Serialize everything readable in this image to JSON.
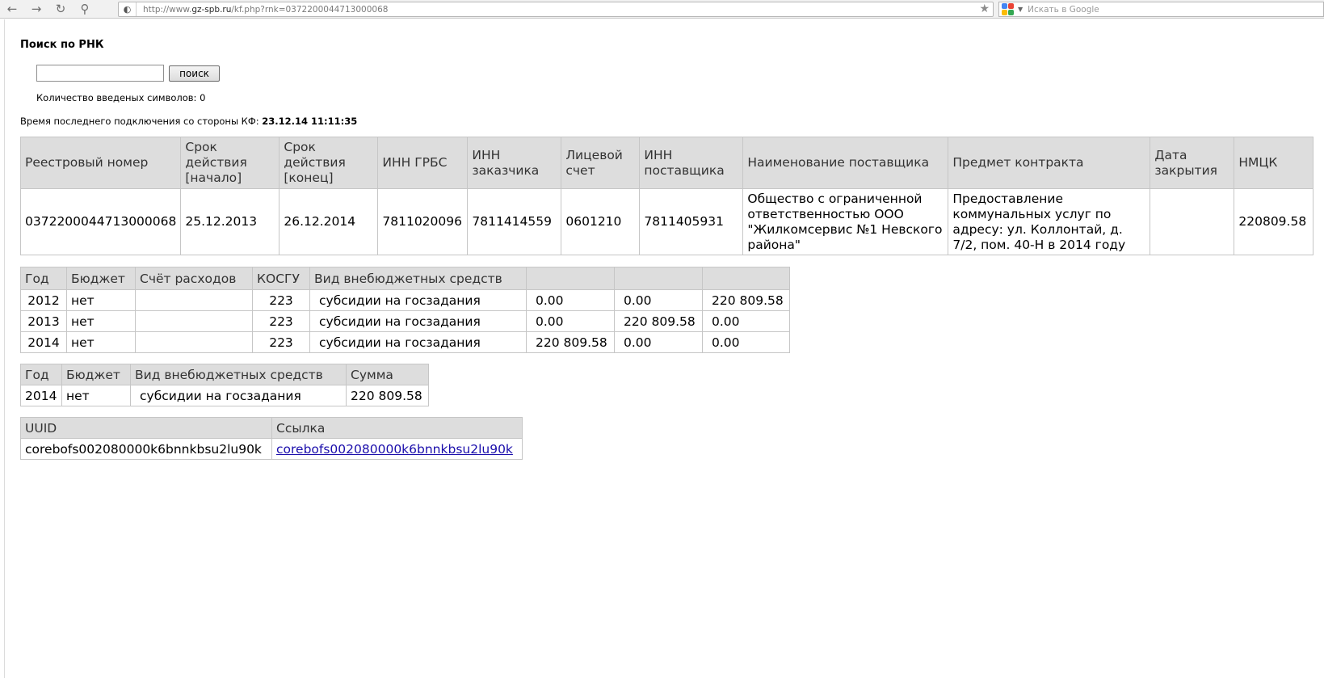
{
  "browser": {
    "url_prefix": "http://www.",
    "url_host": "gz-spb.ru",
    "url_path": "/kf.php?rnk=0372200044713000068",
    "search_placeholder": "Искать в Google"
  },
  "page": {
    "heading": "Поиск по РНК",
    "search_value": "",
    "search_button": "поиск",
    "char_count_label": "Количество введеных символов: 0",
    "last_conn_label": "Время последнего подключения со стороны КФ:",
    "last_conn_value": "23.12.14 11:11:35"
  },
  "contract_table": {
    "headers": [
      "Реестровый номер",
      "Срок действия [начало]",
      "Срок действия [конец]",
      "ИНН ГРБС",
      "ИНН заказчика",
      "Лицевой счет",
      "ИНН поставщика",
      "Наименование поставщика",
      "Предмет контракта",
      "Дата закрытия",
      "НМЦК"
    ],
    "row": [
      "0372200044713000068",
      "25.12.2013",
      "26.12.2014",
      "7811020096",
      "7811414559",
      "0601210",
      "7811405931",
      "Общество с ограниченной ответственностью ООО \"Жилкомсервис №1 Невского района\"",
      "Предоставление коммунальных услуг по адресу: ул. Коллонтай, д. 7/2, пом. 40-Н в 2014 году",
      "",
      "220809.58"
    ]
  },
  "budget_table": {
    "headers": [
      "Год",
      "Бюджет",
      "Счёт расходов",
      "КОСГУ",
      "Вид внебюджетных средств",
      "",
      "",
      ""
    ],
    "rows": [
      [
        "2012",
        "нет",
        "",
        "223",
        "субсидии на госзадания",
        "0.00",
        "0.00",
        "220 809.58"
      ],
      [
        "2013",
        "нет",
        "",
        "223",
        "субсидии на госзадания",
        "0.00",
        "220 809.58",
        "0.00"
      ],
      [
        "2014",
        "нет",
        "",
        "223",
        "субсидии на госзадания",
        "220 809.58",
        "0.00",
        "0.00"
      ]
    ]
  },
  "sum_table": {
    "headers": [
      "Год",
      "Бюджет",
      "Вид внебюджетных средств",
      "Сумма"
    ],
    "row": [
      "2014",
      "нет",
      "субсидии на госзадания",
      "220 809.58"
    ]
  },
  "uuid_table": {
    "headers": [
      "UUID",
      "Ссылка"
    ],
    "row": [
      "corebofs002080000k6bnnkbsu2lu90k",
      "corebofs002080000k6bnnkbsu2lu90k"
    ]
  },
  "colors": {
    "header_bg": "#dddddd",
    "border": "#c6c6c6",
    "link": "#1a0dab"
  }
}
